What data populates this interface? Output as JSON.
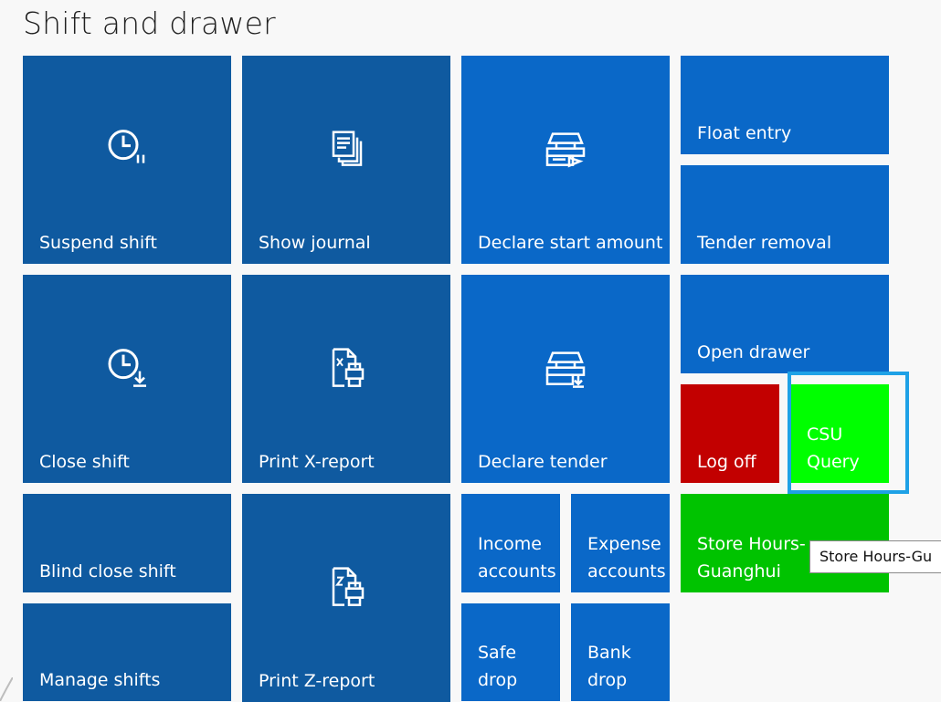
{
  "page": {
    "title": "Shift and drawer"
  },
  "tiles": {
    "suspend_shift": {
      "label": "Suspend shift",
      "icon": "clock-pause-icon"
    },
    "show_journal": {
      "label": "Show journal",
      "icon": "journal-icon"
    },
    "declare_start_amount": {
      "label": "Declare start amount",
      "icon": "cash-drawer-start-icon"
    },
    "float_entry": {
      "label": "Float entry"
    },
    "tender_removal": {
      "label": "Tender removal"
    },
    "close_shift": {
      "label": "Close shift",
      "icon": "clock-download-icon"
    },
    "print_x_report": {
      "label": "Print X-report",
      "icon": "print-x-report-icon"
    },
    "declare_tender": {
      "label": "Declare tender",
      "icon": "cash-drawer-down-icon"
    },
    "open_drawer": {
      "label": "Open drawer"
    },
    "log_off": {
      "label": "Log off"
    },
    "csu_query": {
      "label": "CSU\nQuery"
    },
    "blind_close_shift": {
      "label": "Blind close shift"
    },
    "print_z_report": {
      "label": "Print Z-report",
      "icon": "print-z-report-icon"
    },
    "income_accounts": {
      "label": "Income\naccounts"
    },
    "expense_accounts": {
      "label": "Expense\naccounts"
    },
    "store_hours": {
      "label": "Store Hours-\nGuanghui"
    },
    "manage_shifts": {
      "label": "Manage shifts"
    },
    "safe_drop": {
      "label": "Safe\ndrop"
    },
    "bank_drop": {
      "label": "Bank\ndrop"
    }
  },
  "tooltip": {
    "text": "Store Hours-Gu"
  },
  "colors": {
    "tile_dark": "#0f5aa0",
    "tile_mid": "#0a68c8",
    "log_off": "#c20000",
    "csu_query": "#00ff00",
    "store_hours": "#00c300",
    "focus": "#1ea1e6"
  }
}
